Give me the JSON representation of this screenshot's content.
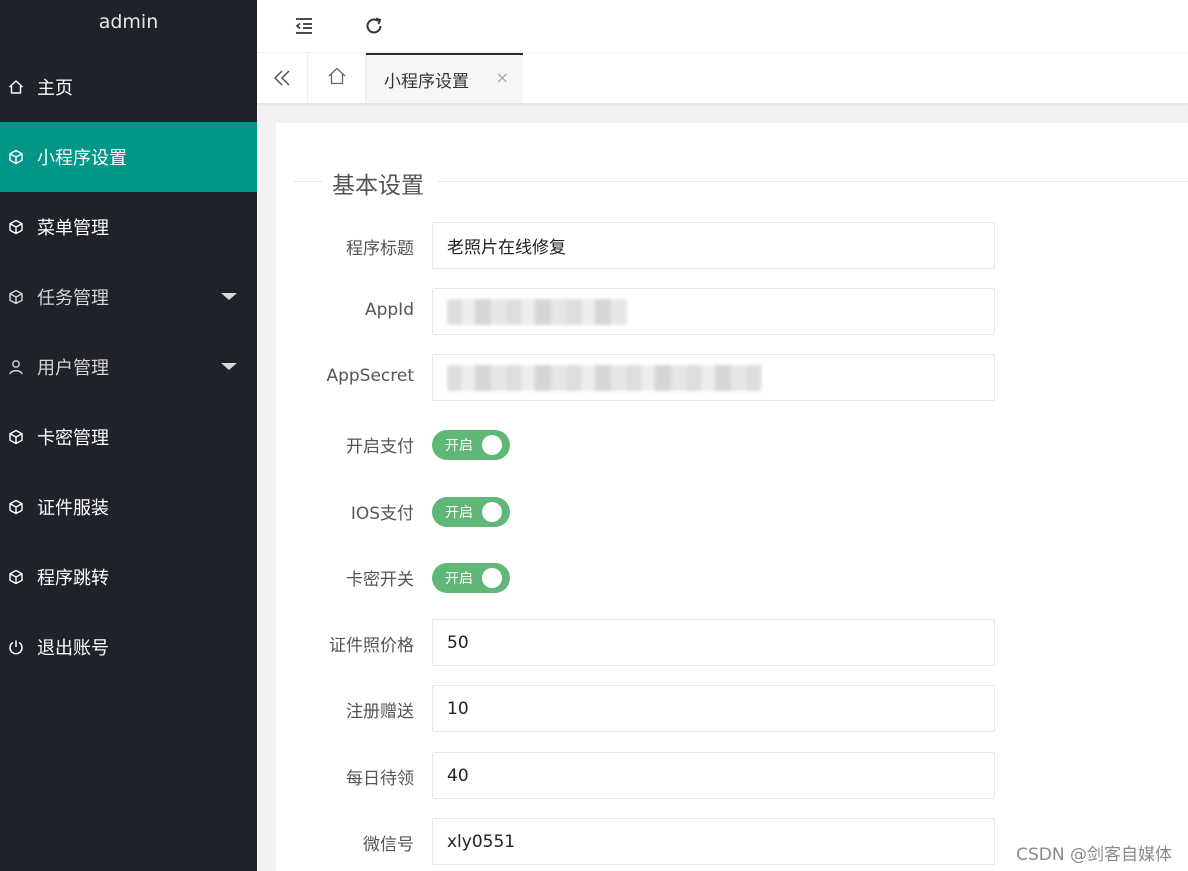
{
  "sidebar": {
    "logo": "admin",
    "items": [
      {
        "label": "主页",
        "icon": "home-icon"
      },
      {
        "label": "小程序设置",
        "icon": "cube-icon",
        "active": true
      },
      {
        "label": "菜单管理",
        "icon": "cube-icon"
      },
      {
        "label": "任务管理",
        "icon": "cube-icon",
        "has_caret": true
      },
      {
        "label": "用户管理",
        "icon": "user-icon",
        "has_caret": true
      },
      {
        "label": "卡密管理",
        "icon": "cube-icon"
      },
      {
        "label": "证件服装",
        "icon": "cube-icon"
      },
      {
        "label": "程序跳转",
        "icon": "cube-icon"
      },
      {
        "label": "退出账号",
        "icon": "power-icon"
      }
    ]
  },
  "header": {
    "collapse_icon": "indent-icon",
    "refresh_icon": "refresh-icon"
  },
  "tabs": {
    "scroll_left_icon": "double-chevron-left-icon",
    "home_icon": "home-icon",
    "active_tab": {
      "label": "小程序设置",
      "close": "×"
    }
  },
  "form": {
    "section_title": "基本设置",
    "fields": {
      "title": {
        "label": "程序标题",
        "value": "老照片在线修复"
      },
      "appid": {
        "label": "AppId",
        "value": ""
      },
      "appsecret": {
        "label": "AppSecret",
        "value": ""
      },
      "pay": {
        "label": "开启支付",
        "switch_text": "开启",
        "on": true
      },
      "ios_pay": {
        "label": "IOS支付",
        "switch_text": "开启",
        "on": true
      },
      "card": {
        "label": "卡密开关",
        "switch_text": "开启",
        "on": true
      },
      "price": {
        "label": "证件照价格",
        "value": "50"
      },
      "register_gift": {
        "label": "注册赠送",
        "value": "10"
      },
      "daily": {
        "label": "每日待领",
        "value": "40"
      },
      "wechat": {
        "label": "微信号",
        "value": "xly0551"
      }
    }
  },
  "watermark": "CSDN @剑客自媒体",
  "colors": {
    "sidebar_bg": "#20222a",
    "active_item": "#009688",
    "switch_on": "#5fb878"
  }
}
